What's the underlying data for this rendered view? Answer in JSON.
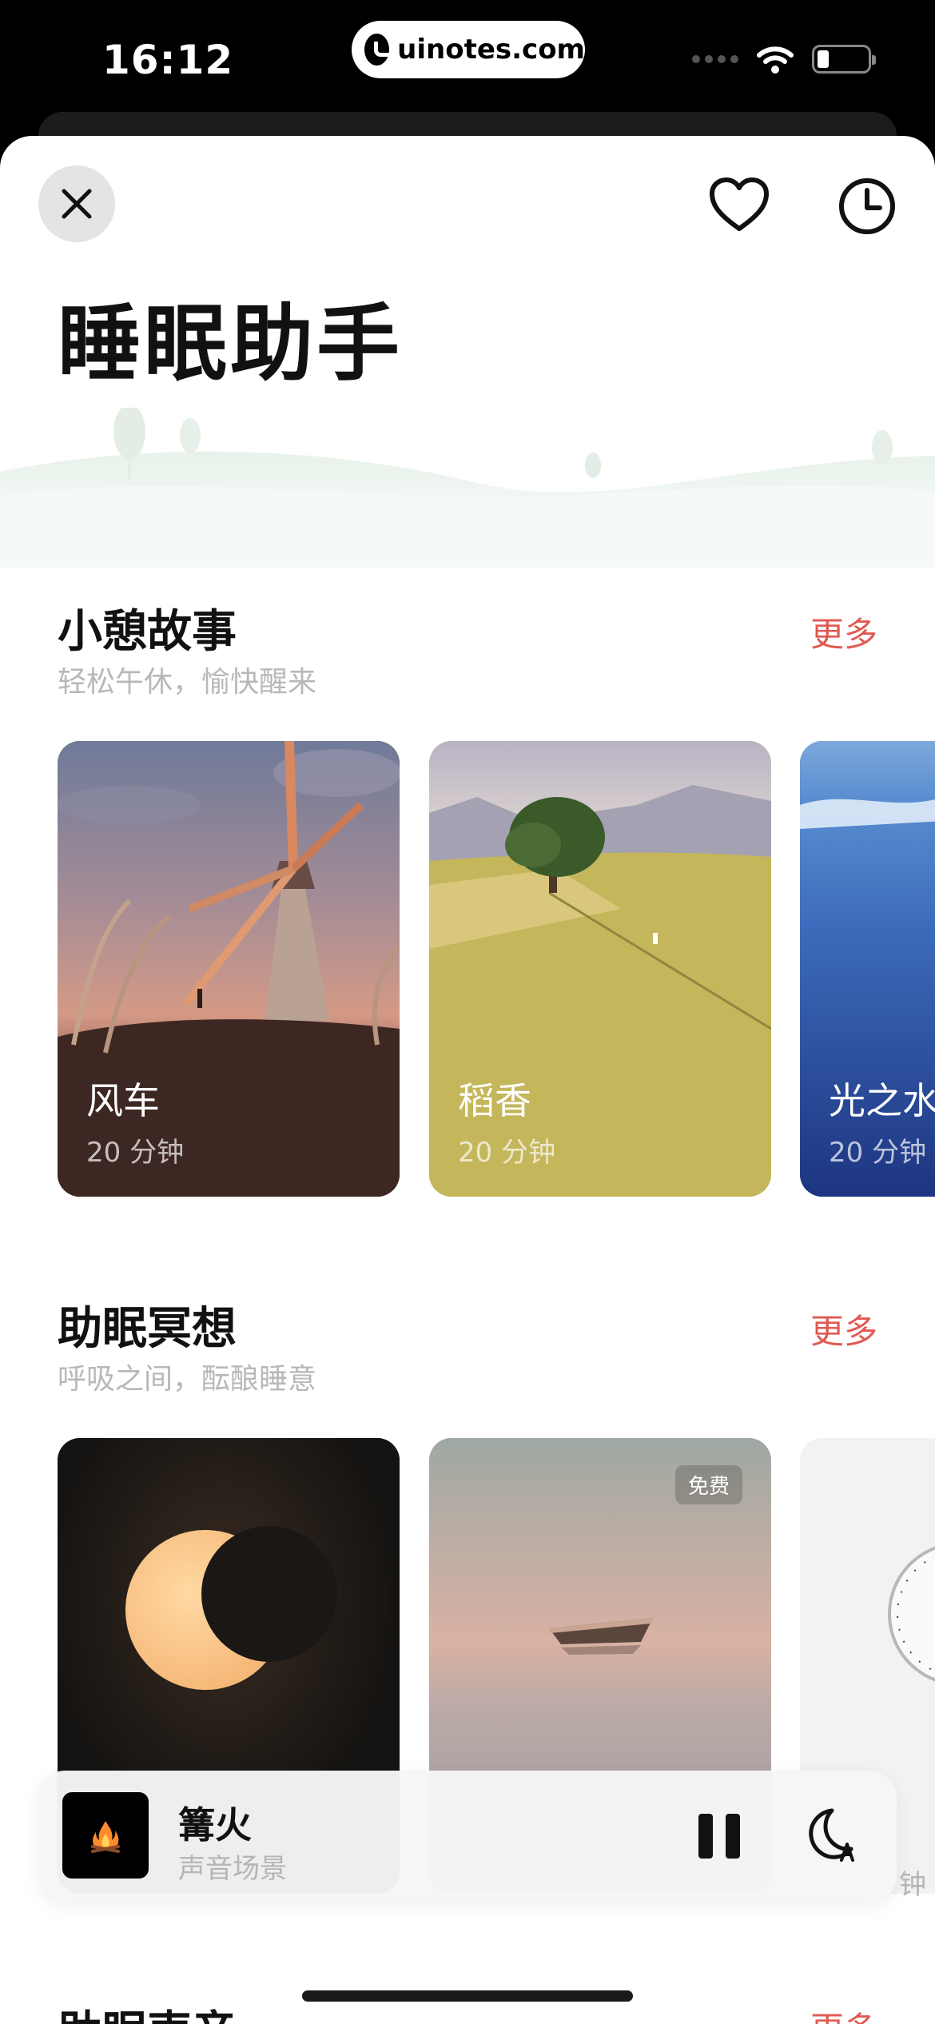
{
  "status_bar": {
    "time": "16:12",
    "url": "uinotes.com"
  },
  "header": {
    "title": "睡眠助手"
  },
  "sections": [
    {
      "title": "小憩故事",
      "subtitle": "轻松午休，愉快醒来",
      "more": "更多",
      "cards": [
        {
          "title": "风车",
          "duration": "20 分钟"
        },
        {
          "title": "稻香",
          "duration": "20 分钟"
        },
        {
          "title": "光之水",
          "duration": "20 分钟"
        }
      ]
    },
    {
      "title": "助眠冥想",
      "subtitle": "呼吸之间，酝酿睡意",
      "more": "更多",
      "cards": [
        {
          "title": "",
          "duration": ""
        },
        {
          "title": "",
          "duration": "",
          "badge": "免费"
        },
        {
          "title": "",
          "duration": ""
        }
      ]
    }
  ],
  "player": {
    "title": "篝火",
    "subtitle": "声音场景"
  },
  "peek": {
    "text": "钟"
  },
  "next_section": {
    "title": "助眠声音",
    "more": "更多"
  },
  "colors": {
    "accent": "#e05a52",
    "subtitle": "#b8b8b8"
  },
  "icons": [
    "close-icon",
    "heart-icon",
    "clock-icon",
    "wifi-icon",
    "battery-icon",
    "campfire-icon",
    "pause-icon",
    "moon-timer-icon"
  ]
}
